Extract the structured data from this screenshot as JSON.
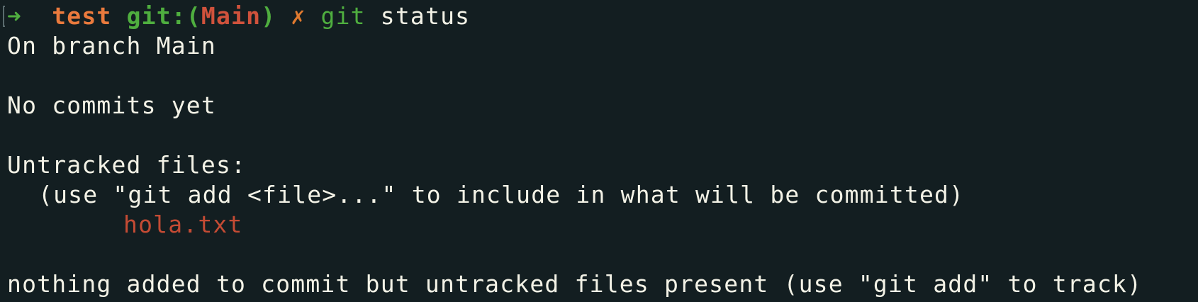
{
  "prompt": {
    "arrow": "➜",
    "directory": "test",
    "git_label": "git:(",
    "branch": "Main",
    "close_paren": ")",
    "dirty_marker": "✗",
    "command": "git",
    "command_args": "status"
  },
  "output": {
    "branch_line": "On branch Main",
    "commits_line": "No commits yet",
    "untracked_header": "Untracked files:",
    "untracked_hint": "(use \"git add <file>...\" to include in what will be committed)",
    "untracked_files": [
      "hola.txt"
    ],
    "summary_line": "nothing added to commit but untracked files present (use \"git add\" to track)"
  },
  "colors": {
    "background": "#131e21",
    "foreground": "#f3f2e6",
    "green": "#4fae3f",
    "orange": "#ea7a3d",
    "red": "#d0523c",
    "untracked": "#c44b34"
  }
}
